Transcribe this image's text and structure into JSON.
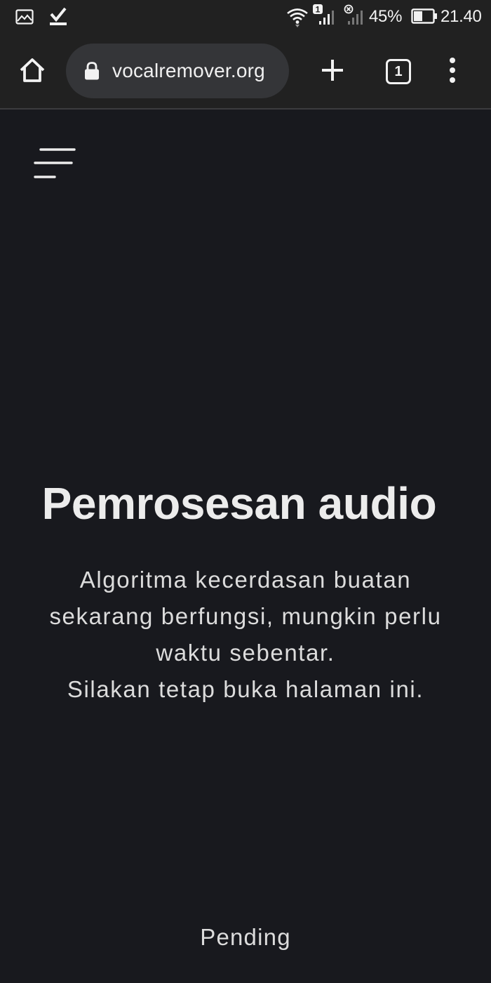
{
  "status_bar": {
    "sim1_badge": "1",
    "battery_percent": "45%",
    "clock": "21.40",
    "icons": [
      "gallery-icon",
      "download-complete-icon",
      "wifi-icon",
      "signal-icon",
      "signal-no-service-icon",
      "battery-icon"
    ]
  },
  "browser": {
    "url": "vocalremover.org",
    "tab_count": "1",
    "icons": [
      "home-icon",
      "lock-icon",
      "plus-icon",
      "tab-switcher-icon",
      "more-vert-icon"
    ]
  },
  "page": {
    "menu_icon": "hamburger-menu-icon",
    "title": "Pemrosesan audio",
    "description_lines": [
      "Algoritma kecerdasan buatan",
      "sekarang berfungsi, mungkin perlu",
      "waktu sebentar.",
      "Silakan tetap buka halaman ini."
    ],
    "status": "Pending"
  },
  "colors": {
    "background": "#18191e",
    "toolbar": "#212121",
    "url_bar": "#343538",
    "text": "#ececec"
  }
}
